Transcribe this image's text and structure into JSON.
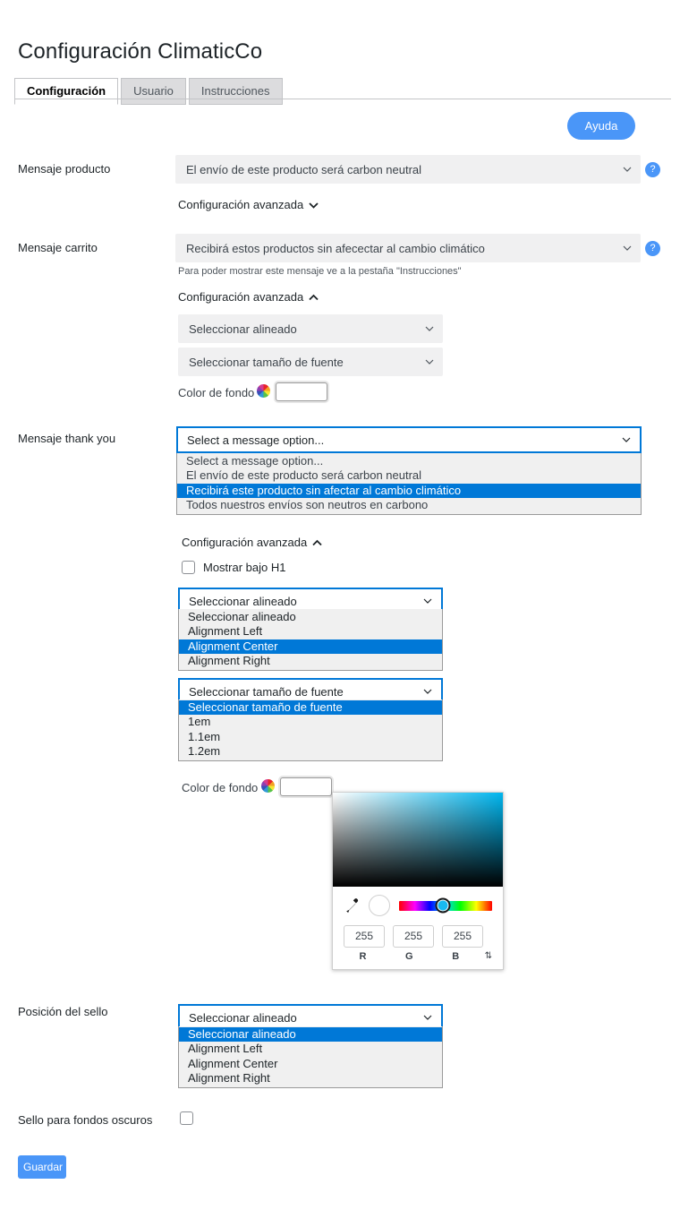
{
  "header": {
    "title": "Configuración ClimaticCo",
    "tabs": [
      {
        "label": "Configuración",
        "active": true
      },
      {
        "label": "Usuario",
        "active": false
      },
      {
        "label": "Instrucciones",
        "active": false
      }
    ],
    "help_button": "Ayuda",
    "help_icon": "question-mark-icon"
  },
  "product_message": {
    "label": "Mensaje producto",
    "value": "El envío de este producto será carbon neutral",
    "help_tooltip": "?",
    "advanced_label": "Configuración avanzada",
    "advanced_caret": "▼"
  },
  "cart_message": {
    "label": "Mensaje carrito",
    "value": "Recibirá estos productos sin afecectar al cambio climático",
    "help_tooltip": "?",
    "hint": "Para poder mostrar este mensaje ve a la pestaña \"Instrucciones\"",
    "advanced_label": "Configuración avanzada",
    "advanced_caret": "▲",
    "alignment_value": "Seleccionar alineado",
    "font_size_value": "Seleccionar tamaño de fuente",
    "color_label": "Color de fondo",
    "color_value": ""
  },
  "thankyou_message": {
    "label": "Mensaje thank you",
    "value": "Select a message option...",
    "options": [
      "Select a message option...",
      "El envío de este producto será carbon neutral",
      "Recibirá este producto sin afectar al cambio climático",
      "Todos nuestros envíos son neutros en carbono"
    ],
    "selected_index": 2,
    "advanced_label": "Configuración avanzada",
    "advanced_caret": "▲",
    "checkbox_label": "Mostrar bajo H1",
    "checkbox_checked": false,
    "alignment_value": "Seleccionar alineado",
    "alignment_options": [
      "Seleccionar alineado",
      "Alignment Left",
      "Alignment Center",
      "Alignment Right"
    ],
    "alignment_selected_index": 2,
    "font_size_value": "Seleccionar tamaño de fuente",
    "font_size_options": [
      "Seleccionar tamaño de fuente",
      "1em",
      "1.1em",
      "1.2em"
    ],
    "font_size_selected_index": 0,
    "color_label": "Color de fondo",
    "color_value": ""
  },
  "color_picker": {
    "eyedropper_icon": "eyedropper-icon",
    "hue_value": 192,
    "rgb": {
      "r": "255",
      "g": "255",
      "b": "255"
    },
    "labels": {
      "r": "R",
      "g": "G",
      "b": "B"
    },
    "mode_switch": "⇅"
  },
  "seal_position": {
    "label": "Posición del sello",
    "value": "Seleccionar alineado",
    "options": [
      "Seleccionar alineado",
      "Alignment Left",
      "Alignment Center",
      "Alignment Right"
    ],
    "selected_index": 0
  },
  "dark_seal": {
    "label": "Sello para fondos oscuros",
    "checked": false
  },
  "footer": {
    "save_label": "Guardar"
  },
  "colors": {
    "accent": "#4a96f8",
    "highlight": "#0078d7",
    "field_bg": "#f0f0f1",
    "border": "#c3c4c7"
  }
}
